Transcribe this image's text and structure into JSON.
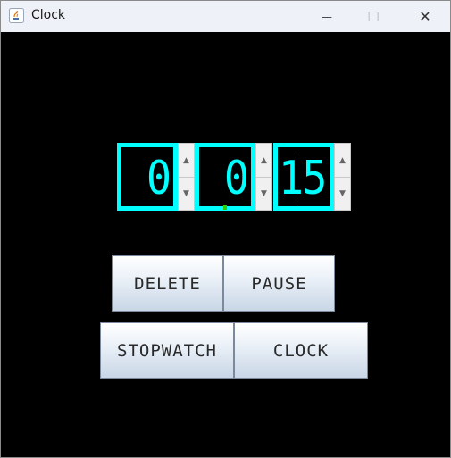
{
  "window": {
    "title": "Clock"
  },
  "titlebar": {
    "minimize_glyph": "—",
    "maximize_glyph": "☐",
    "close_glyph": "✕"
  },
  "spinners": {
    "hours": {
      "value": "0"
    },
    "minutes": {
      "value": "0"
    },
    "seconds": {
      "value": "15"
    },
    "up_glyph": "▲",
    "down_glyph": "▼"
  },
  "buttons": {
    "delete": "DELETE",
    "pause": "PAUSE",
    "stopwatch": "STOPWATCH",
    "clock": "CLOCK"
  },
  "colors": {
    "digit": "#00ffff",
    "background": "#000000",
    "accent_green": "#33cc00"
  }
}
